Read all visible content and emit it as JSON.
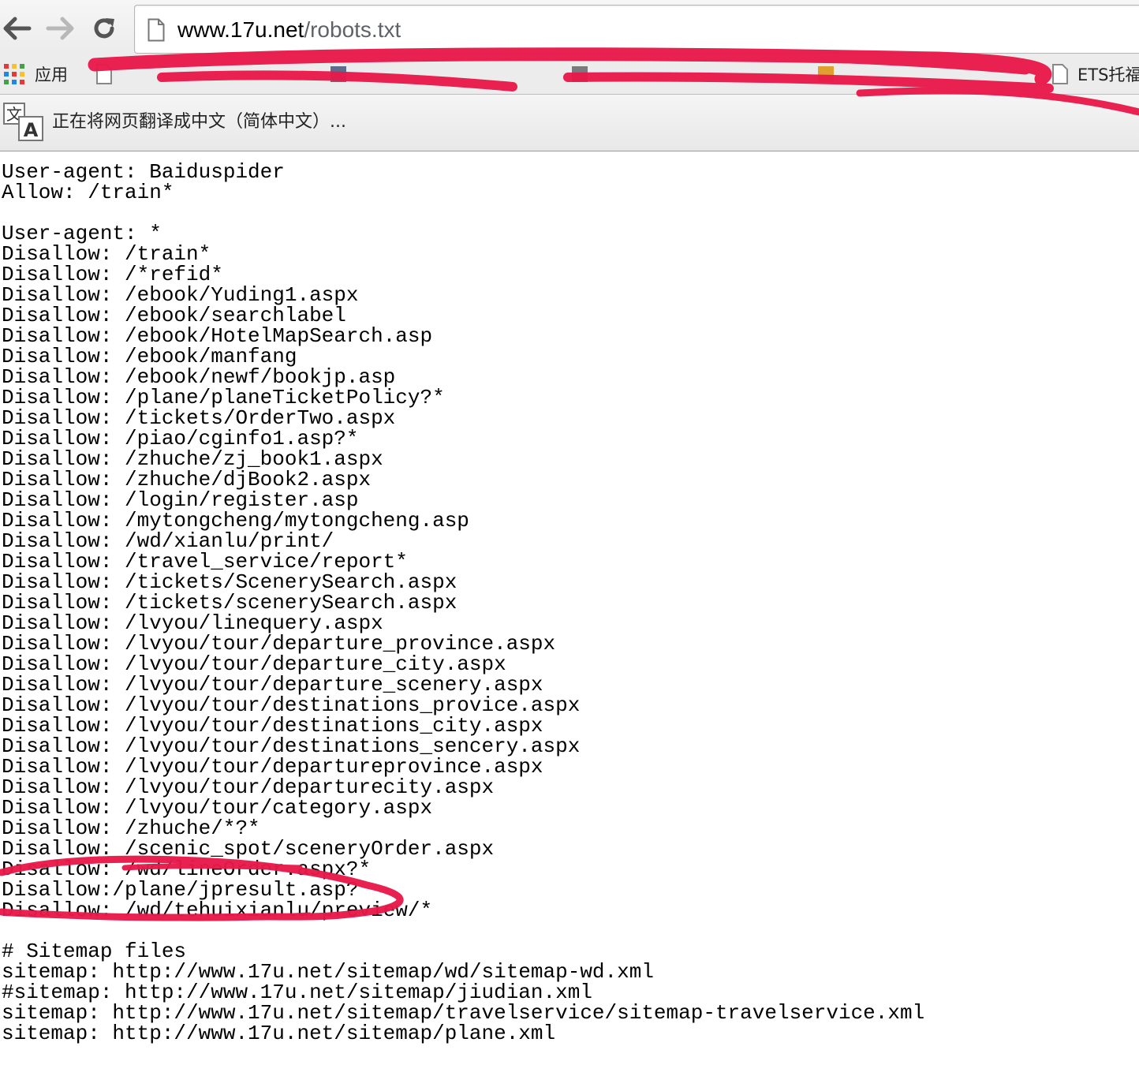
{
  "address_bar": {
    "host": "www.17u.net",
    "path": "/robots.txt"
  },
  "bookmarks": {
    "apps_label": "应用",
    "partial_label": "ETS托福"
  },
  "translate_bar": {
    "message": "正在将网页翻译成中文（简体中文）..."
  },
  "robots_txt": {
    "lines": [
      "User-agent: Baiduspider",
      "Allow: /train*",
      "",
      "User-agent: *",
      "Disallow: /train*",
      "Disallow: /*refid*",
      "Disallow: /ebook/Yuding1.aspx",
      "Disallow: /ebook/searchlabel",
      "Disallow: /ebook/HotelMapSearch.asp",
      "Disallow: /ebook/manfang",
      "Disallow: /ebook/newf/bookjp.asp",
      "Disallow: /plane/planeTicketPolicy?*",
      "Disallow: /tickets/OrderTwo.aspx",
      "Disallow: /piao/cginfo1.asp?*",
      "Disallow: /zhuche/zj_book1.aspx",
      "Disallow: /zhuche/djBook2.aspx",
      "Disallow: /login/register.asp",
      "Disallow: /mytongcheng/mytongcheng.asp",
      "Disallow: /wd/xianlu/print/",
      "Disallow: /travel_service/report*",
      "Disallow: /tickets/ScenerySearch.aspx",
      "Disallow: /tickets/scenerySearch.aspx",
      "Disallow: /lvyou/linequery.aspx",
      "Disallow: /lvyou/tour/departure_province.aspx",
      "Disallow: /lvyou/tour/departure_city.aspx",
      "Disallow: /lvyou/tour/departure_scenery.aspx",
      "Disallow: /lvyou/tour/destinations_provice.aspx",
      "Disallow: /lvyou/tour/destinations_city.aspx",
      "Disallow: /lvyou/tour/destinations_sencery.aspx",
      "Disallow: /lvyou/tour/departureprovince.aspx",
      "Disallow: /lvyou/tour/departurecity.aspx",
      "Disallow: /lvyou/tour/category.aspx",
      "Disallow: /zhuche/*?*",
      "Disallow: /scenic_spot/sceneryOrder.aspx",
      "Disallow: /wd/lineOrder.aspx?*",
      "Disallow:/plane/jpresult.asp?",
      "Disallow: /wd/tehuixianlu/preview/*",
      "",
      "# Sitemap files",
      "sitemap: http://www.17u.net/sitemap/wd/sitemap-wd.xml",
      "#sitemap: http://www.17u.net/sitemap/jiudian.xml",
      "sitemap: http://www.17u.net/sitemap/travelservice/sitemap-travelservice.xml",
      "sitemap: http://www.17u.net/sitemap/plane.xml"
    ]
  },
  "colors": {
    "annotation": "#e8194a",
    "url_path": "#5f6368"
  },
  "icons": {
    "back": "arrow-left-icon",
    "forward": "arrow-right-icon",
    "reload": "reload-icon",
    "page": "page-icon",
    "apps": "apps-grid-icon",
    "translate": "translate-icon"
  }
}
